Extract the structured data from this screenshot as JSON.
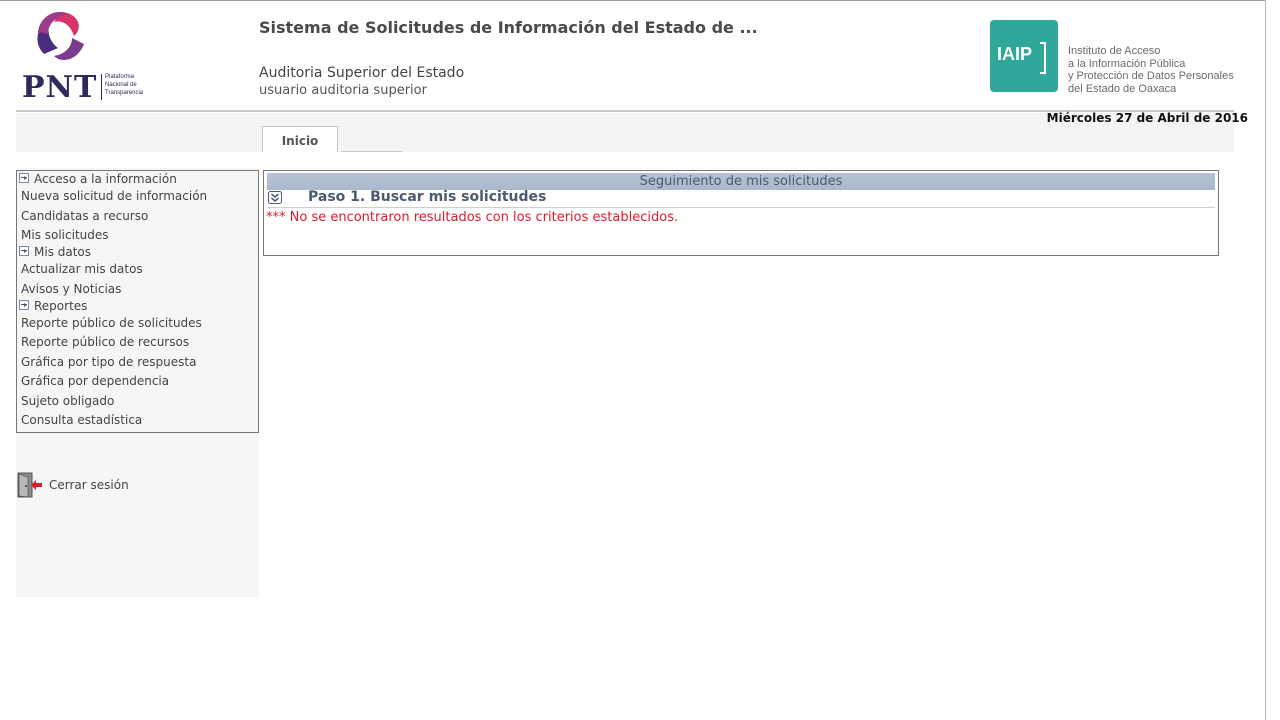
{
  "branding": {
    "pnt_word": "PNT",
    "pnt_sub": [
      "Plataforma",
      "Nacional de",
      "Transparencia"
    ],
    "iaip_text": "IAIP",
    "iaip_desc": [
      "Instituto de Acceso",
      "a la Información Pública",
      "y Protección de Datos Personales",
      "del Estado de Oaxaca"
    ]
  },
  "header": {
    "system_title": "Sistema de Solicitudes de Información del Estado de ...",
    "entity": "Auditoria Superior del Estado",
    "user": "usuario auditoria superior",
    "date": "Miércoles 27 de Abril de 2016"
  },
  "tabs": {
    "inicio": "Inicio"
  },
  "sidebar": {
    "sections": {
      "acceso": "Acceso a la información",
      "mis_datos": "Mis datos",
      "reportes": "Reportes"
    },
    "items": {
      "nueva_solicitud": "Nueva solicitud de información",
      "candidatas": "Candidatas a recurso",
      "mis_solicitudes": "Mis solicitudes",
      "actualizar": "Actualizar mis datos",
      "avisos": "Avisos y Noticias",
      "reporte_solicitudes": "Reporte público de solicitudes",
      "reporte_recursos": "Reporte público de recursos",
      "grafica_respuesta": "Gráfica por tipo de respuesta",
      "grafica_dependencia": "Gráfica por dependencia",
      "sujeto": "Sujeto obligado",
      "consulta": "Consulta estadística"
    },
    "logout": "Cerrar sesión"
  },
  "main": {
    "panel_title": "Seguimiento de mis solicitudes",
    "step_label": "Paso 1. Buscar mis solicitudes",
    "no_results": "*** No se encontraron resultados con los criterios establecidos."
  },
  "colors": {
    "accent_teal": "#2fa79a",
    "panel_header": "#b5c3d3",
    "error_red": "#e3192d"
  }
}
